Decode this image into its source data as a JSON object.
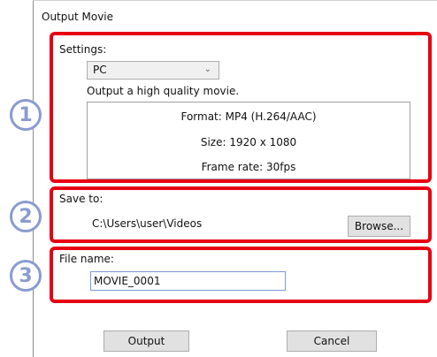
{
  "dialog": {
    "title": "Output Movie"
  },
  "settings": {
    "label": "Settings:",
    "preset": "PC",
    "description": "Output a high quality movie.",
    "format": "Format: MP4 (H.264/AAC)",
    "size": "Size: 1920 x 1080",
    "frame_rate": "Frame rate: 30fps"
  },
  "save": {
    "label": "Save to:",
    "path": "C:\\Users\\user\\Videos",
    "browse_label": "Browse..."
  },
  "file": {
    "label": "File name:",
    "value": "MOVIE_0001"
  },
  "footer": {
    "output_label": "Output",
    "cancel_label": "Cancel"
  },
  "callouts": [
    "1",
    "2",
    "3"
  ]
}
